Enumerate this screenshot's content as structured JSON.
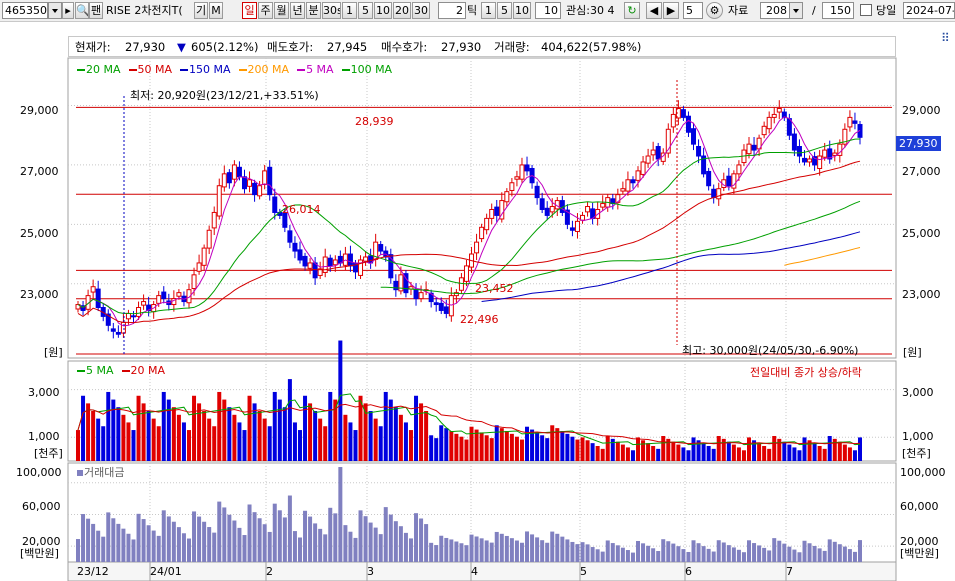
{
  "toolbar": {
    "code": "465350",
    "search_icon": "search-icon",
    "link_label": "팬",
    "name": "RISE 2차전지T(",
    "btn_gi": "기",
    "btn_m": "M",
    "periods": [
      "일",
      "주",
      "월",
      "년",
      "분",
      "30s",
      "1",
      "5",
      "10",
      "20",
      "30"
    ],
    "tick_count": "2",
    "tick_label": "틱",
    "tick_opts": [
      "1",
      "5",
      "10"
    ],
    "tick_value": "10",
    "interest_label": "관심:30 4",
    "step_value": "5",
    "data_label": "자료",
    "data_count": "208",
    "slash": "/",
    "total_count": "150",
    "today_label": "당일",
    "date": "2024-07-"
  },
  "info": {
    "current_label": "현재가:",
    "current_value": "27,930",
    "change": "605(2.12%)",
    "ask_label": "매도호가:",
    "ask_value": "27,945",
    "bid_label": "매수호가:",
    "bid_value": "27,930",
    "volume_label": "거래량:",
    "volume_value": "404,622(57.98%)"
  },
  "price_legend": [
    {
      "label": "20 MA",
      "color": "#00a000"
    },
    {
      "label": "50 MA",
      "color": "#d40000"
    },
    {
      "label": "150 MA",
      "color": "#0000c0"
    },
    {
      "label": "200 MA",
      "color": "#ff9900"
    },
    {
      "label": "5 MA",
      "color": "#c000c0"
    },
    {
      "label": "100 MA",
      "color": "#00a000"
    }
  ],
  "volume_legend": [
    {
      "label": "5 MA",
      "color": "#00a000"
    },
    {
      "label": "20 MA",
      "color": "#d40000"
    }
  ],
  "amount_legend": {
    "label": "거래대금",
    "color": "#8080c0"
  },
  "annotations": {
    "low_note": "최저: 20,920원(23/12/21,+33.51%)",
    "high_note": "최고: 30,000원(24/05/30,-6.90%)",
    "vol_note": "전일대비 종가 상승/하락",
    "level_28939": "28,939",
    "level_26014": "26,014",
    "level_23452": "23,452",
    "level_22496": "22,496",
    "current_price_tag": "27,930"
  },
  "axes": {
    "price_ticks": [
      "29,000",
      "27,000",
      "25,000",
      "23,000"
    ],
    "price_unit": "[원]",
    "vol_ticks": [
      "3,000",
      "1,000"
    ],
    "vol_unit": "[천주]",
    "amt_ticks": [
      "100,000",
      "60,000",
      "20,000"
    ],
    "amt_unit": "[백만원]",
    "x_labels": [
      "23/12",
      "24/01",
      "2",
      "3",
      "4",
      "5",
      "6",
      "7"
    ]
  },
  "colors": {
    "up": "#e00000",
    "down": "#0000e0",
    "grid": "#c8c8c8",
    "hline": "#d00000",
    "ma5": "#c000c0",
    "ma20": "#00a000",
    "ma50": "#d40000",
    "ma150": "#0000c0",
    "ma200": "#ff9900",
    "amount": "#8080c0"
  }
}
